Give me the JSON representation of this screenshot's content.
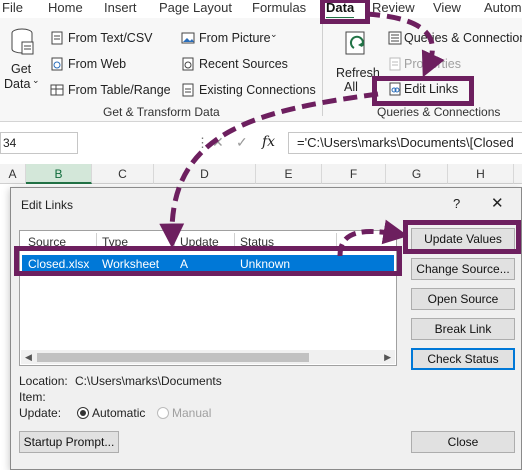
{
  "ribbon_tabs": [
    "File",
    "Home",
    "Insert",
    "Page Layout",
    "Formulas",
    "Data",
    "Review",
    "View",
    "Autom"
  ],
  "get_data": {
    "line1": "Get",
    "line2": "Data"
  },
  "get_transform": {
    "items": [
      "From Text/CSV",
      "From Web",
      "From Table/Range",
      "From Picture",
      "Recent Sources",
      "Existing Connections"
    ],
    "label": "Get & Transform Data"
  },
  "queries": {
    "refresh_line1": "Refresh",
    "refresh_line2": "All",
    "queries_connections": "Queries & Connections",
    "properties": "Properties",
    "edit_links": "Edit Links",
    "label": "Queries & Connections"
  },
  "formula_bar": {
    "namebox": "34",
    "fx": "fx",
    "formula": "='C:\\Users\\marks\\Documents\\[Closed"
  },
  "columns": [
    "A",
    "B",
    "C",
    "D",
    "E",
    "F",
    "G",
    "H"
  ],
  "dialog": {
    "title": "Edit Links",
    "help": "?",
    "close": "✕",
    "headers": [
      "Source",
      "Type",
      "Update",
      "Status"
    ],
    "row": [
      "Closed.xlsx",
      "Worksheet",
      "A",
      "Unknown"
    ],
    "buttons": {
      "update_values": "Update Values",
      "change_source": "Change Source...",
      "open_source": "Open Source",
      "break_link": "Break Link",
      "check_status": "Check Status",
      "startup_prompt": "Startup Prompt...",
      "close": "Close"
    },
    "location_label": "Location:",
    "location_value": "C:\\Users\\marks\\Documents",
    "item_label": "Item:",
    "update_label": "Update:",
    "automatic": "Automatic",
    "manual": "Manual"
  },
  "colors": {
    "accent": "#217346",
    "highlight": "#6d1f5f",
    "selection": "#0078d7"
  }
}
